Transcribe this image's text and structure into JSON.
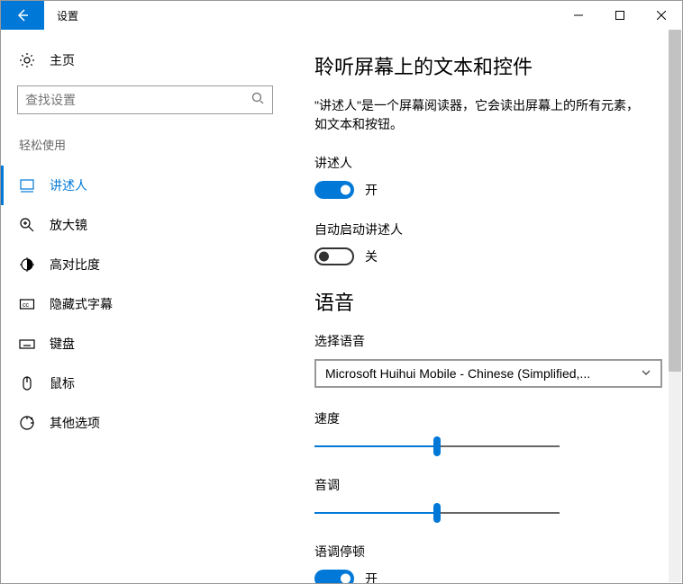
{
  "window": {
    "title": "设置"
  },
  "sidebar": {
    "home": "主页",
    "search_placeholder": "查找设置",
    "category": "轻松使用",
    "items": [
      {
        "label": "讲述人"
      },
      {
        "label": "放大镜"
      },
      {
        "label": "高对比度"
      },
      {
        "label": "隐藏式字幕"
      },
      {
        "label": "键盘"
      },
      {
        "label": "鼠标"
      },
      {
        "label": "其他选项"
      }
    ]
  },
  "main": {
    "heading": "聆听屏幕上的文本和控件",
    "description": "\"讲述人\"是一个屏幕阅读器，它会读出屏幕上的所有元素，如文本和按钮。",
    "narrator_label": "讲述人",
    "narrator_state": "开",
    "autostart_label": "自动启动讲述人",
    "autostart_state": "关",
    "voice_heading": "语音",
    "choose_voice_label": "选择语音",
    "voice_selected": "Microsoft Huihui Mobile - Chinese (Simplified,...",
    "speed_label": "速度",
    "pitch_label": "音调",
    "pause_label": "语调停顿",
    "pause_state": "开"
  }
}
